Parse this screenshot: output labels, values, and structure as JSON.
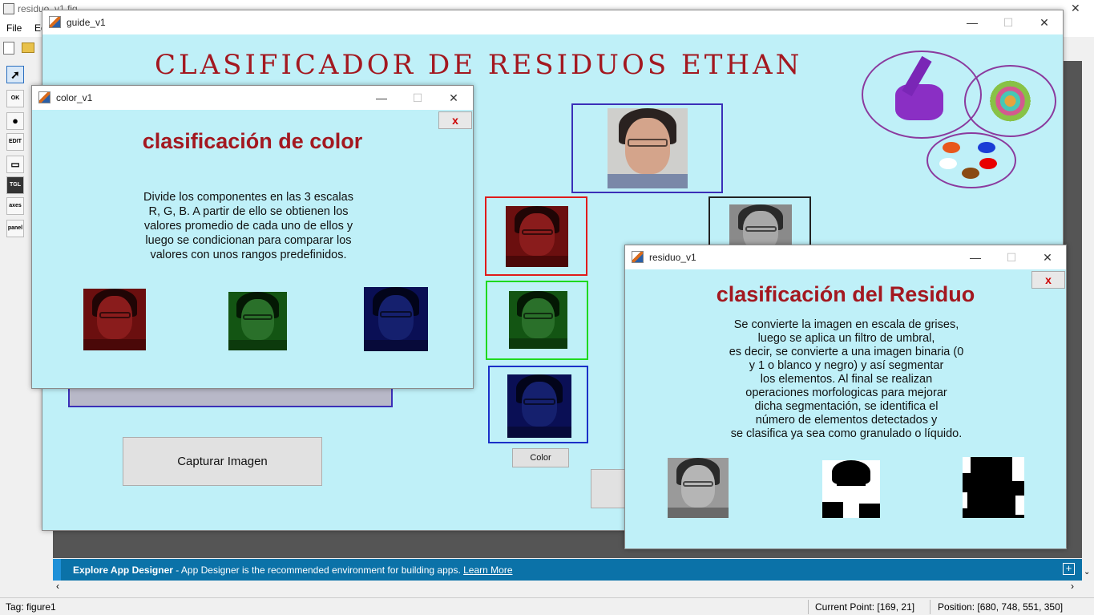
{
  "editor": {
    "title": "residuo_v1.fig",
    "menus": [
      "File",
      "Ed"
    ],
    "info_bold": "Explore App Designer",
    "info_text": " - App Designer is the recommended environment for building apps. ",
    "info_link": "Learn More",
    "status_tag": "Tag: figure1",
    "status_point": "Current Point:  [169, 21]",
    "status_position": "Position: [680, 748, 551, 350]",
    "palette": [
      "OK",
      "●",
      "EDIT",
      "▭",
      "TGL",
      "axes",
      "panel"
    ]
  },
  "guide": {
    "title": "guide_v1",
    "banner": "CLASIFICADOR DE RESIDUOS ETHAN",
    "capture_button": "Capturar Imagen",
    "color_button": "Color",
    "logo_colors": [
      "#e8571c",
      "#1b3dd6",
      "#ffffff",
      "#e80000",
      "#8a4a12"
    ]
  },
  "color_win": {
    "title": "color_v1",
    "close_label": "x",
    "heading": "clasificación de color",
    "paragraph": [
      "Divide los componentes en las 3 escalas",
      "R, G, B. A partir de ello se obtienen los",
      "valores promedio de cada uno de ellos y",
      "luego se condicionan para comparar los",
      " valores con unos rangos predefinidos."
    ]
  },
  "residuo_win": {
    "title": "residuo_v1",
    "close_label": "x",
    "heading": "clasificación del Residuo",
    "paragraph": [
      "Se convierte la imagen en escala de grises,",
      "luego se aplica un filtro de umbral,",
      "es decir, se convierte a una imagen binaria (0",
      "y 1 o blanco y negro) y así segmentar",
      "los elementos. Al final se realizan",
      "operaciones morfologicas para mejorar",
      "dicha segmentación, se identifica el",
      "número de elementos detectados y",
      "se clasifica ya sea como granulado o líquido."
    ]
  }
}
